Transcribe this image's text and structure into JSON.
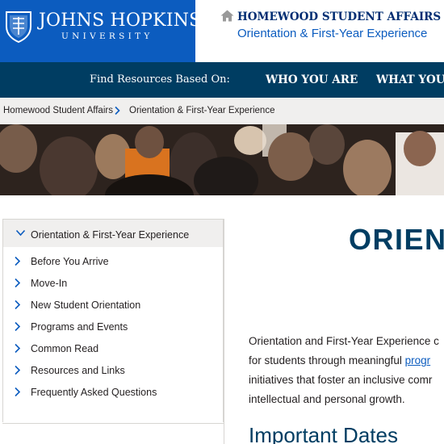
{
  "header": {
    "logo_main": "JOHNS HOPKINS",
    "logo_sub": "UNIVERSITY",
    "site_title": "HOMEWOOD STUDENT AFFAIRS",
    "site_subtitle": "Orientation & First-Year Experience",
    "colors": {
      "brand_blue": "#0c5cbf",
      "navy": "#002d72"
    }
  },
  "nav": {
    "label": "Find Resources Based On:",
    "items": [
      "WHO YOU ARE",
      "WHAT YOU"
    ],
    "color": "#003d62"
  },
  "breadcrumb": {
    "items": [
      "Homewood Student Affairs",
      "Orientation & First-Year Experience"
    ]
  },
  "sidebar": {
    "active": "Orientation & First-Year Experience",
    "items": [
      "Before You Arrive",
      "Move-In",
      "New Student Orientation",
      "Programs and Events",
      "Common Read",
      "Resources and Links",
      "Frequently Asked Questions"
    ]
  },
  "main": {
    "heading": "ORIEN",
    "paragraph": {
      "line1": "Orientation and First-Year Experience c",
      "line2_text": "for students through meaningful ",
      "line2_link": "progr",
      "line3": "initiatives that foster an inclusive comr",
      "line4": "intellectual and personal growth."
    },
    "subheading": "Important Dates"
  },
  "icons": {
    "shield": "jhu-shield-icon",
    "home": "home-icon",
    "chevron_right": "chevron-right-icon",
    "chevron_down": "chevron-down-icon"
  }
}
